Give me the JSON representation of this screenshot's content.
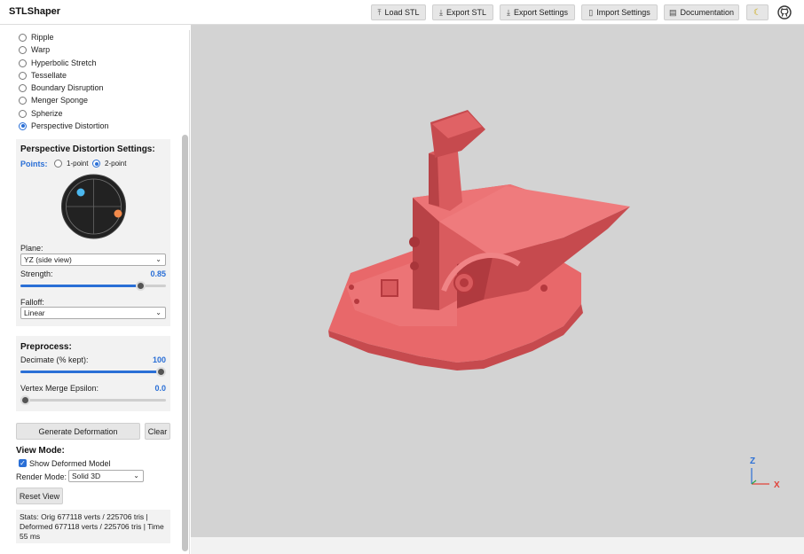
{
  "app": {
    "title": "STLShaper"
  },
  "toolbar": {
    "load_stl": "Load STL",
    "export_stl": "Export STL",
    "export_settings": "Export Settings",
    "import_settings": "Import Settings",
    "documentation": "Documentation"
  },
  "deformations": {
    "items": [
      {
        "label": "Ripple",
        "selected": false
      },
      {
        "label": "Warp",
        "selected": false
      },
      {
        "label": "Hyperbolic Stretch",
        "selected": false
      },
      {
        "label": "Tessellate",
        "selected": false
      },
      {
        "label": "Boundary Disruption",
        "selected": false
      },
      {
        "label": "Menger Sponge",
        "selected": false
      },
      {
        "label": "Spherize",
        "selected": false
      },
      {
        "label": "Perspective Distortion",
        "selected": true
      }
    ]
  },
  "perspective": {
    "title": "Perspective Distortion Settings:",
    "points_label": "Points:",
    "point_options": [
      "1-point",
      "2-point"
    ],
    "point_selected": "2-point",
    "plane_label": "Plane:",
    "plane_value": "YZ (side view)",
    "strength_label": "Strength:",
    "strength_value": "0.85",
    "strength_fraction": 0.85,
    "falloff_label": "Falloff:",
    "falloff_value": "Linear",
    "vp_colors": {
      "point1": "#4cb8ef",
      "point2": "#f28a4b"
    }
  },
  "preprocess": {
    "title": "Preprocess:",
    "decimate_label": "Decimate (% kept):",
    "decimate_value": "100",
    "decimate_fraction": 1.0,
    "epsilon_label": "Vertex Merge Epsilon:",
    "epsilon_value": "0.0",
    "epsilon_fraction": 0.0
  },
  "actions": {
    "generate": "Generate Deformation",
    "clear": "Clear"
  },
  "view_mode": {
    "title": "View Mode:",
    "show_deformed_label": "Show Deformed Model",
    "show_deformed_checked": true,
    "render_mode_label": "Render Mode:",
    "render_mode_value": "Solid 3D",
    "reset_view": "Reset View"
  },
  "stats": {
    "text": "Stats: Orig 677118 verts / 225706 tris | Deformed 677118 verts / 225706 tris | Time 55 ms"
  },
  "axes": {
    "z_label": "Z",
    "x_label": "X",
    "z_color": "#2a6fd6",
    "x_color": "#e0433a"
  },
  "colors": {
    "accent": "#2a6fd6",
    "model": "#e8686a",
    "viewport_bg": "#d3d3d3"
  }
}
